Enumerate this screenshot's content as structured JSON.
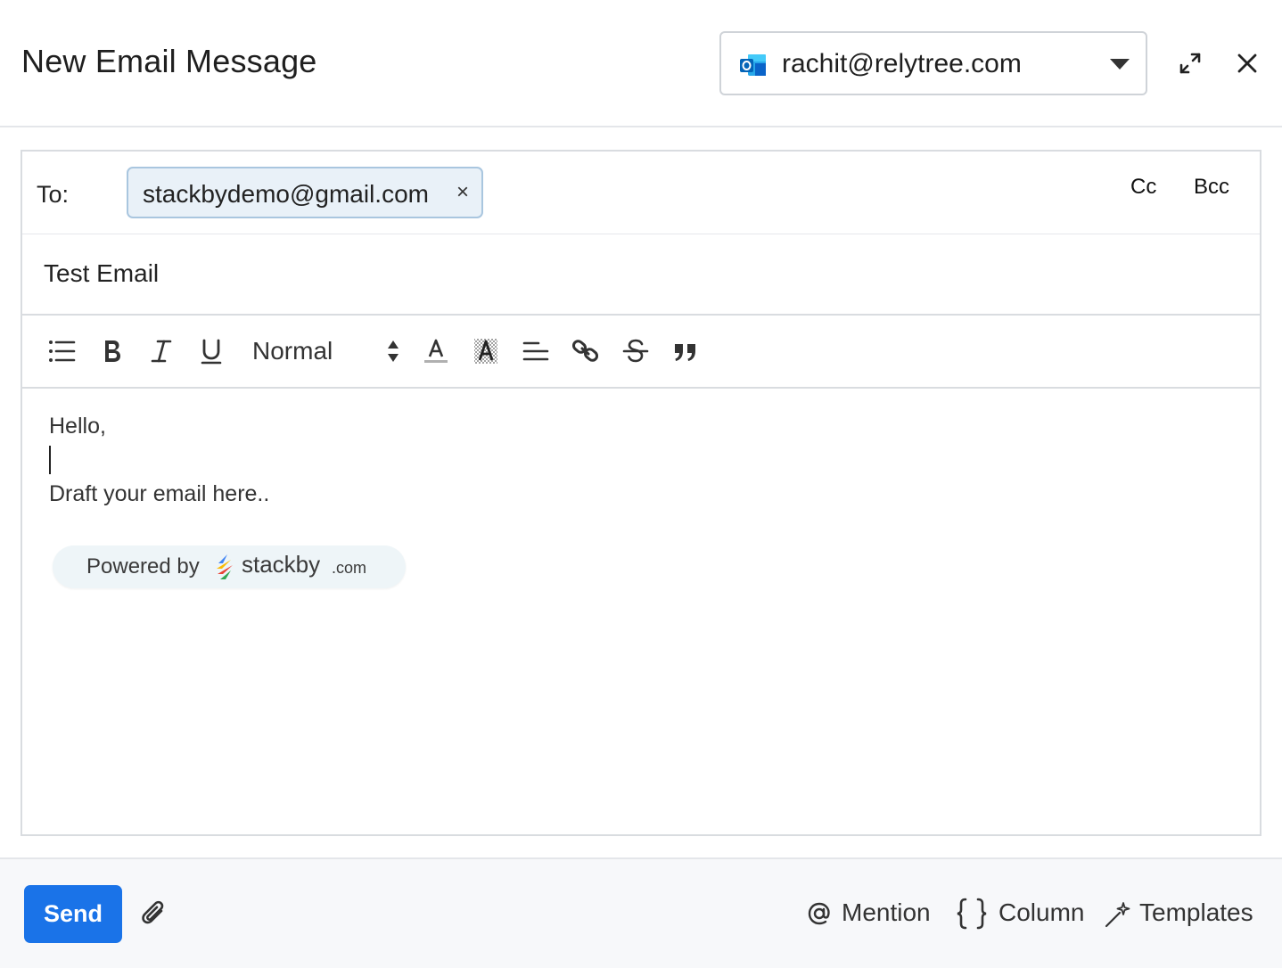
{
  "header": {
    "title": "New Email Message",
    "account": "rachit@relytree.com"
  },
  "compose": {
    "to_label": "To:",
    "recipient": "stackbydemo@gmail.com",
    "remove_symbol": "×",
    "cc_label": "Cc",
    "bcc_label": "Bcc",
    "subject": "Test Email"
  },
  "toolbar": {
    "format_value": "Normal"
  },
  "editor": {
    "line1": "Hello,",
    "line2": "Draft your email here..",
    "powered_by": "Powered by",
    "brand": "stackby",
    "brand_suffix": ".com"
  },
  "footer": {
    "send_label": "Send",
    "mention_label": "Mention",
    "column_label": "Column",
    "templates_label": "Templates"
  },
  "icons": {
    "account": "outlook-icon",
    "expand": "expand-icon",
    "close": "close-icon",
    "toolbar": [
      "bulleted-list-icon",
      "bold-icon",
      "italic-icon",
      "underline-icon",
      "sort-arrows-icon",
      "text-color-icon",
      "highlight-icon",
      "align-left-icon",
      "link-icon",
      "strikethrough-icon",
      "quote-icon"
    ],
    "attach": "paperclip-icon",
    "mention": "at-sign-icon",
    "column": "braces-icon",
    "templates": "magic-wand-icon"
  },
  "colors": {
    "accent": "#1a73e8",
    "chip_bg": "#e9f1f8",
    "chip_border": "#a9c6df",
    "footer_bg": "#f7f8fa"
  }
}
